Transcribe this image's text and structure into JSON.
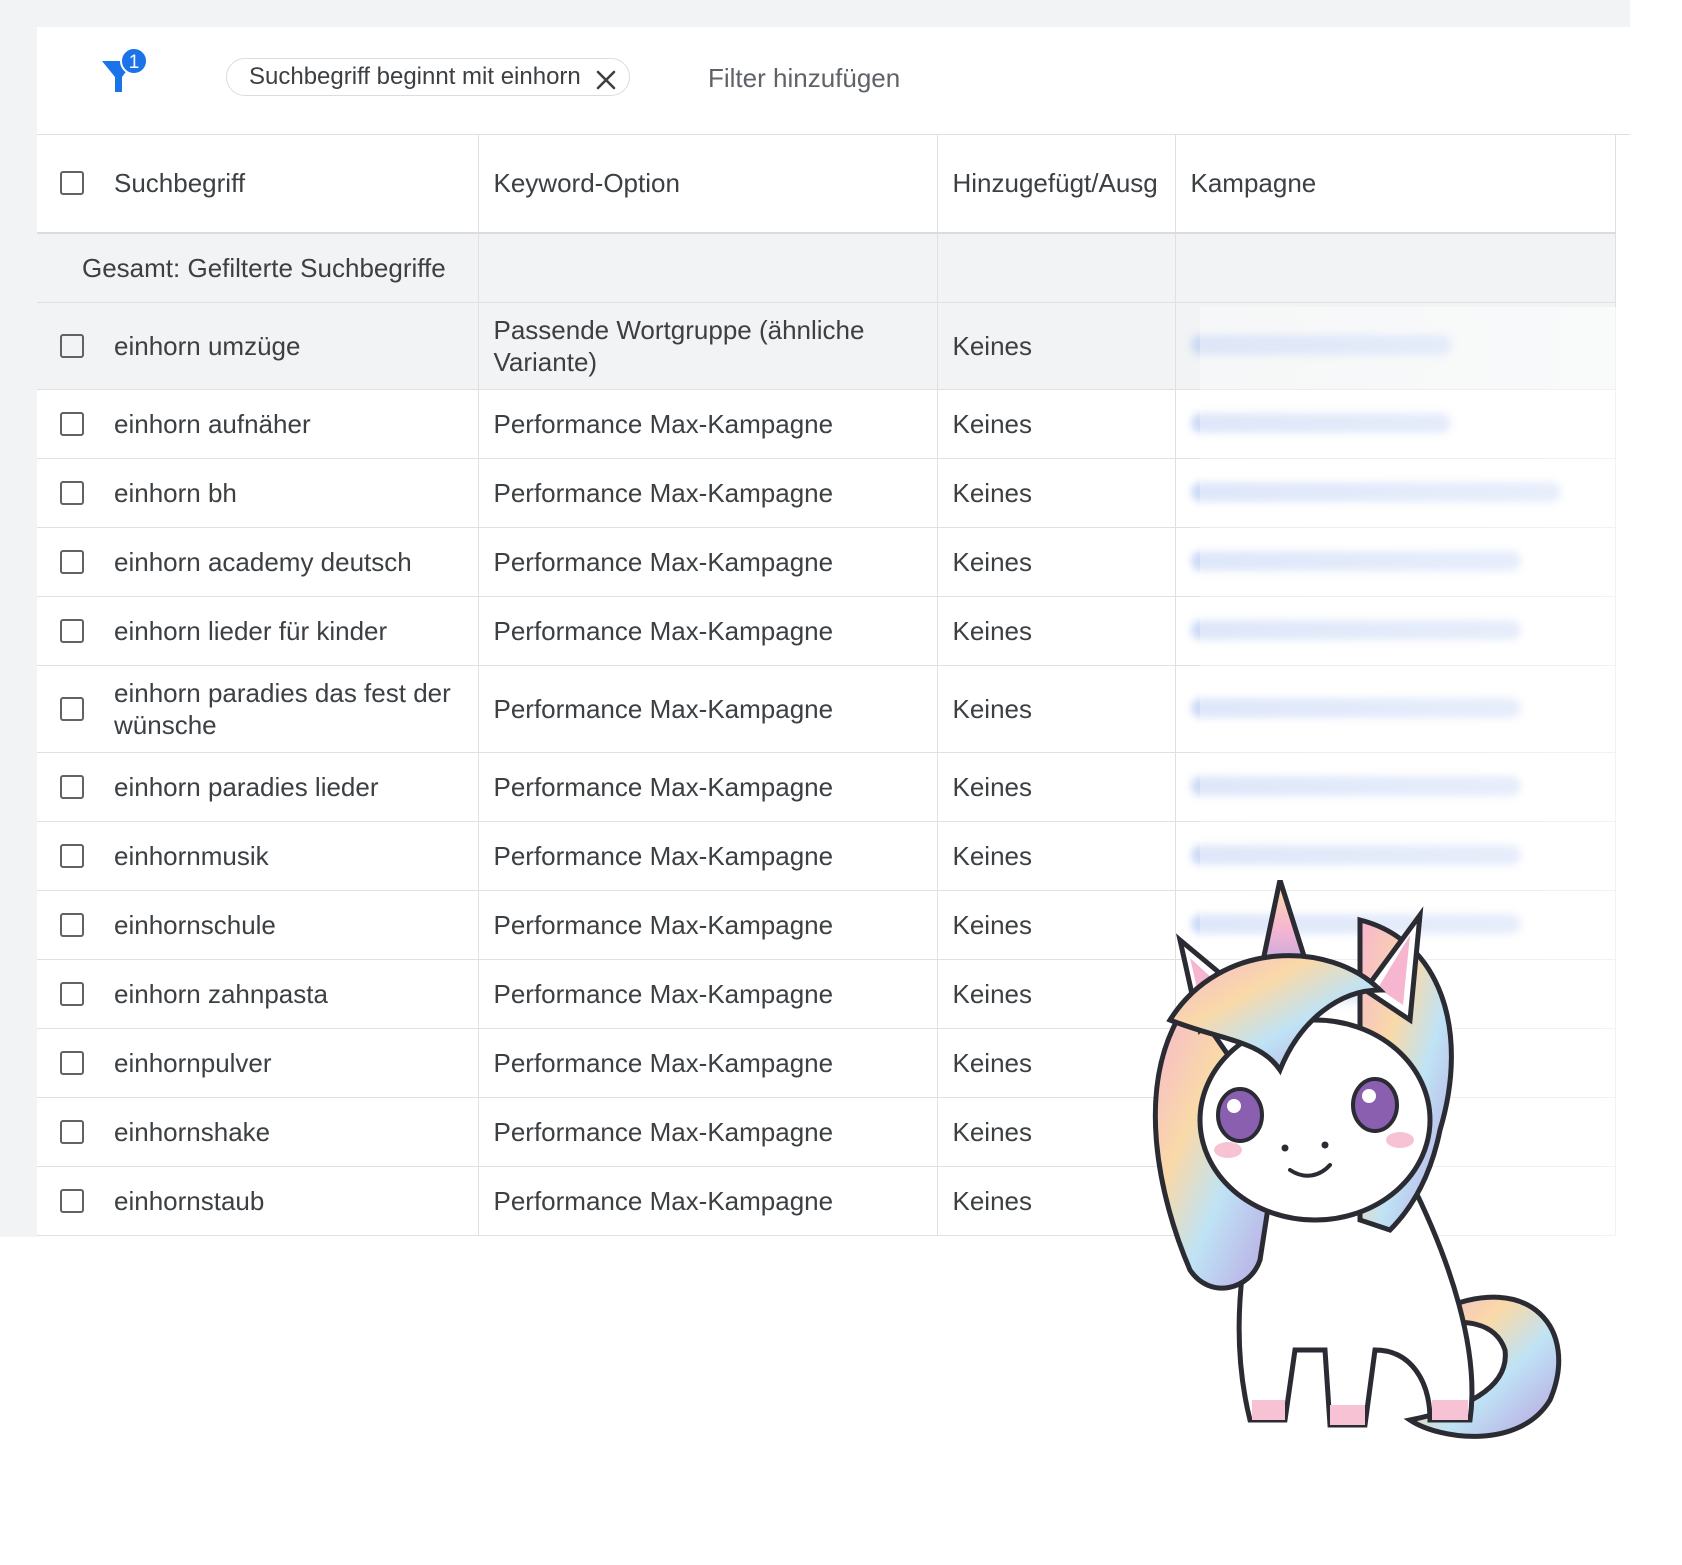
{
  "filter": {
    "count_badge": "1",
    "chip_label": "Suchbegriff beginnt mit einhorn",
    "add_filter_label": "Filter hinzufügen"
  },
  "table": {
    "headers": [
      "Suchbegriff",
      "Keyword-Option",
      "Hinzugefügt/Ausg",
      "Kampagne"
    ],
    "total_label": "Gesamt: Gefilterte Suchbegriffe",
    "rows": [
      {
        "term": "einhorn umzüge",
        "option": "Passende Wortgruppe (ähnliche Variante)",
        "added": "Keines"
      },
      {
        "term": "einhorn aufnäher",
        "option": "Performance Max-Kampagne",
        "added": "Keines"
      },
      {
        "term": "einhorn bh",
        "option": "Performance Max-Kampagne",
        "added": "Keines"
      },
      {
        "term": "einhorn academy deutsch",
        "option": "Performance Max-Kampagne",
        "added": "Keines"
      },
      {
        "term": "einhorn lieder für kinder",
        "option": "Performance Max-Kampagne",
        "added": "Keines"
      },
      {
        "term": "einhorn paradies das fest der wünsche",
        "option": "Performance Max-Kampagne",
        "added": "Keines"
      },
      {
        "term": "einhorn paradies lieder",
        "option": "Performance Max-Kampagne",
        "added": "Keines"
      },
      {
        "term": "einhornmusik",
        "option": "Performance Max-Kampagne",
        "added": "Keines"
      },
      {
        "term": "einhornschule",
        "option": "Performance Max-Kampagne",
        "added": "Keines"
      },
      {
        "term": "einhorn zahnpasta",
        "option": "Performance Max-Kampagne",
        "added": "Keines"
      },
      {
        "term": "einhornpulver",
        "option": "Performance Max-Kampagne",
        "added": "Keines"
      },
      {
        "term": "einhornshake",
        "option": "Performance Max-Kampagne",
        "added": "Keines"
      },
      {
        "term": "einhornstaub",
        "option": "Performance Max-Kampagne",
        "added": "Keines"
      }
    ]
  },
  "colors": {
    "accent": "#1a73e8",
    "header_bg": "#f1f3f4",
    "text": "#3c4043",
    "campaign_blur": "#c7d6f5"
  },
  "icons": [
    "filter-icon",
    "close-icon",
    "checkbox-icon",
    "unicorn-illustration"
  ]
}
